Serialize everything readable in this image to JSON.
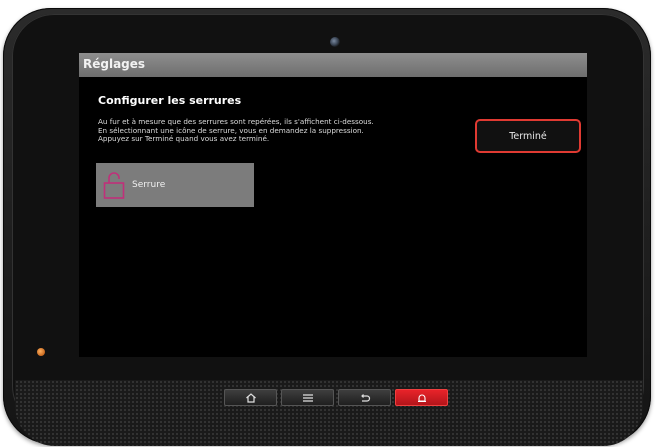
{
  "screen": {
    "title": "Réglages",
    "heading": "Configurer les serrures",
    "description_lines": [
      "Au fur et à mesure que des serrures sont repérées, ils s'affichent ci-dessous.",
      "En sélectionnant une icône de serrure, vous en demandez la suppression.",
      "Appuyez sur Terminé quand vous avez terminé."
    ],
    "done_button": "Terminé",
    "lock_item": {
      "label": "Serrure",
      "icon": "padlock-open-icon"
    }
  },
  "hardware_buttons": [
    {
      "icon": "home-icon"
    },
    {
      "icon": "menu-icon"
    },
    {
      "icon": "back-icon"
    },
    {
      "icon": "alarm-icon"
    }
  ],
  "colors": {
    "screen_bg": "#000000",
    "titlebar": "#7e7e7e",
    "accent_red": "#e03a32",
    "lock_tile": "#7c7c7c",
    "lock_icon": "#c0307a",
    "led": "#c8681e"
  }
}
